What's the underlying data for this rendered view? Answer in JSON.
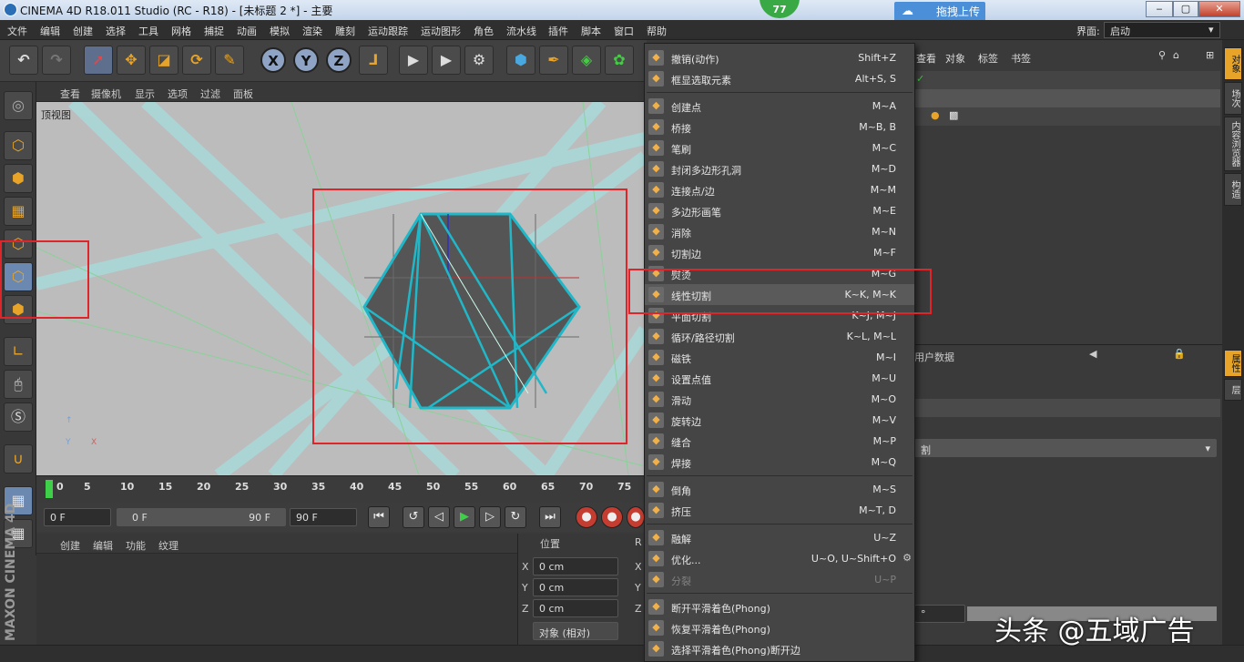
{
  "window": {
    "title": "CINEMA 4D R18.011 Studio (RC - R18) - [未标题 2 *] - 主要",
    "badge": "77",
    "upload": "拖拽上传",
    "min": "‒",
    "max": "▢",
    "close": "✕"
  },
  "menubar": [
    "文件",
    "编辑",
    "创建",
    "选择",
    "工具",
    "网格",
    "捕捉",
    "动画",
    "模拟",
    "渲染",
    "雕刻",
    "运动跟踪",
    "运动图形",
    "角色",
    "流水线",
    "插件",
    "脚本",
    "窗口",
    "帮助"
  ],
  "layout_label": "界面:",
  "layout_value": "启动",
  "viewport": {
    "menu": [
      "查看",
      "摄像机",
      "显示",
      "选项",
      "过滤",
      "面板"
    ],
    "label": "顶视图"
  },
  "timeline": {
    "ticks": [
      "0",
      "5",
      "10",
      "15",
      "20",
      "25",
      "30",
      "35",
      "40",
      "45",
      "50",
      "55",
      "60",
      "65",
      "70",
      "75"
    ],
    "current_frame": "0 F",
    "range_start": "0 F",
    "range_end": "90 F",
    "range_end2": "90 F"
  },
  "materials": {
    "menu": [
      "创建",
      "编辑",
      "功能",
      "纹理"
    ]
  },
  "coords": {
    "title": "位置",
    "x": "0 cm",
    "y": "0 cm",
    "z": "0 cm",
    "mode": "对象 (相对)",
    "r": "R"
  },
  "object_manager": {
    "tabs": [
      "查看",
      "对象",
      "标签",
      "书签"
    ]
  },
  "attributes": {
    "title": "用户数据",
    "dropdown": "割",
    "degree": "°"
  },
  "side_tabs": [
    "对象",
    "场次",
    "内容浏览器",
    "构造"
  ],
  "side_tabs2": [
    "属性",
    "层"
  ],
  "context_menu": [
    {
      "icon": "undo-icon",
      "label": "撤销(动作)",
      "shortcut": "Shift+Z"
    },
    {
      "icon": "frame-icon",
      "label": "框显选取元素",
      "shortcut": "Alt+S, S",
      "sep_after": true
    },
    {
      "icon": "create-point-icon",
      "label": "创建点",
      "shortcut": "M~A"
    },
    {
      "icon": "bridge-icon",
      "label": "桥接",
      "shortcut": "M~B, B"
    },
    {
      "icon": "brush-icon",
      "label": "笔刷",
      "shortcut": "M~C"
    },
    {
      "icon": "close-hole-icon",
      "label": "封闭多边形孔洞",
      "shortcut": "M~D"
    },
    {
      "icon": "connect-icon",
      "label": "连接点/边",
      "shortcut": "M~M"
    },
    {
      "icon": "polygon-pen-icon",
      "label": "多边形画笔",
      "shortcut": "M~E"
    },
    {
      "icon": "dissolve-icon",
      "label": "消除",
      "shortcut": "M~N"
    },
    {
      "icon": "cut-edges-icon",
      "label": "切割边",
      "shortcut": "M~F"
    },
    {
      "icon": "iron-icon",
      "label": "熨烫",
      "shortcut": "M~G"
    },
    {
      "icon": "knife-icon",
      "label": "线性切割",
      "shortcut": "K~K, M~K",
      "highlight": true
    },
    {
      "icon": "plane-cut-icon",
      "label": "平面切割",
      "shortcut": "K~J, M~J"
    },
    {
      "icon": "loop-cut-icon",
      "label": "循环/路径切割",
      "shortcut": "K~L, M~L"
    },
    {
      "icon": "magnet-icon",
      "label": "磁铁",
      "shortcut": "M~I"
    },
    {
      "icon": "set-value-icon",
      "label": "设置点值",
      "shortcut": "M~U"
    },
    {
      "icon": "slide-icon",
      "label": "滑动",
      "shortcut": "M~O"
    },
    {
      "icon": "spin-edge-icon",
      "label": "旋转边",
      "shortcut": "M~V"
    },
    {
      "icon": "stitch-icon",
      "label": "缝合",
      "shortcut": "M~P"
    },
    {
      "icon": "weld-icon",
      "label": "焊接",
      "shortcut": "M~Q",
      "sep_after": true
    },
    {
      "icon": "bevel-icon",
      "label": "倒角",
      "shortcut": "M~S"
    },
    {
      "icon": "extrude-icon",
      "label": "挤压",
      "shortcut": "M~T, D",
      "sep_after": true
    },
    {
      "icon": "disconnect-icon",
      "label": "融解",
      "shortcut": "U~Z"
    },
    {
      "icon": "optimize-icon",
      "label": "优化...",
      "shortcut": "U~O, U~Shift+O",
      "gear": true
    },
    {
      "icon": "split-icon",
      "label": "分裂",
      "shortcut": "U~P",
      "disabled": true,
      "sep_after": true
    },
    {
      "icon": "phong-break-icon",
      "label": "断开平滑着色(Phong)",
      "shortcut": ""
    },
    {
      "icon": "phong-restore-icon",
      "label": "恢复平滑着色(Phong)",
      "shortcut": ""
    },
    {
      "icon": "phong-select-icon",
      "label": "选择平滑着色(Phong)断开边",
      "shortcut": ""
    }
  ],
  "watermark": "头条 @五域广告",
  "colors": {
    "accent": "#e8a428",
    "highlight_box": "#e0252a",
    "mesh": "#20b8c8",
    "viewport_bg": "#bcbcbc"
  }
}
